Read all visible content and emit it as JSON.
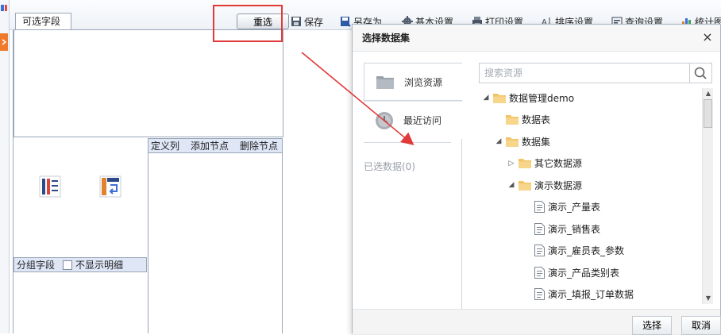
{
  "toolbar": {
    "reselect_label": "重选",
    "items": [
      {
        "label": "保存",
        "icon": "save-icon"
      },
      {
        "label": "另存为",
        "icon": "save-as-icon"
      },
      {
        "label": "基本设置",
        "icon": "gear-icon"
      },
      {
        "label": "打印设置",
        "icon": "printer-icon"
      },
      {
        "label": "排序设置",
        "icon": "sort-icon"
      },
      {
        "label": "查询设置",
        "icon": "query-icon"
      },
      {
        "label": "统计图",
        "icon": "bar-chart-icon"
      }
    ]
  },
  "left_panel": {
    "fields_tab_label": "可选字段",
    "define_header": [
      "定义列",
      "添加节点",
      "删除节点"
    ],
    "group_header_label": "分组字段",
    "hide_detail_label": "不显示明细"
  },
  "dialog": {
    "title": "选择数据集",
    "close_glyph": "×",
    "tabs": [
      {
        "label": "浏览资源",
        "icon": "folder-icon"
      },
      {
        "label": "最近访问",
        "icon": "clock-icon"
      }
    ],
    "selected_count_label": "已选数据(0)",
    "search_placeholder": "搜索资源",
    "tree": [
      {
        "label": "数据管理demo",
        "type": "folder",
        "expanded": true,
        "level": 0
      },
      {
        "label": "数据表",
        "type": "folder",
        "expanded": null,
        "level": 1
      },
      {
        "label": "数据集",
        "type": "folder",
        "expanded": true,
        "level": 1
      },
      {
        "label": "其它数据源",
        "type": "folder",
        "expanded": false,
        "level": 2
      },
      {
        "label": "演示数据源",
        "type": "folder",
        "expanded": true,
        "level": 2
      },
      {
        "label": "演示_产量表",
        "type": "doc",
        "level": 3
      },
      {
        "label": "演示_销售表",
        "type": "doc",
        "level": 3
      },
      {
        "label": "演示_雇员表_参数",
        "type": "doc",
        "level": 3
      },
      {
        "label": "演示_产品类别表",
        "type": "doc",
        "level": 3
      },
      {
        "label": "演示_填报_订单数据",
        "type": "doc",
        "level": 3
      }
    ],
    "ok_label": "选择",
    "cancel_label": "取消"
  },
  "colors": {
    "highlight": "#e23a3a",
    "header_bg": "#dfe6f6",
    "folder": "#f2c466",
    "border": "#9aa7b7"
  }
}
